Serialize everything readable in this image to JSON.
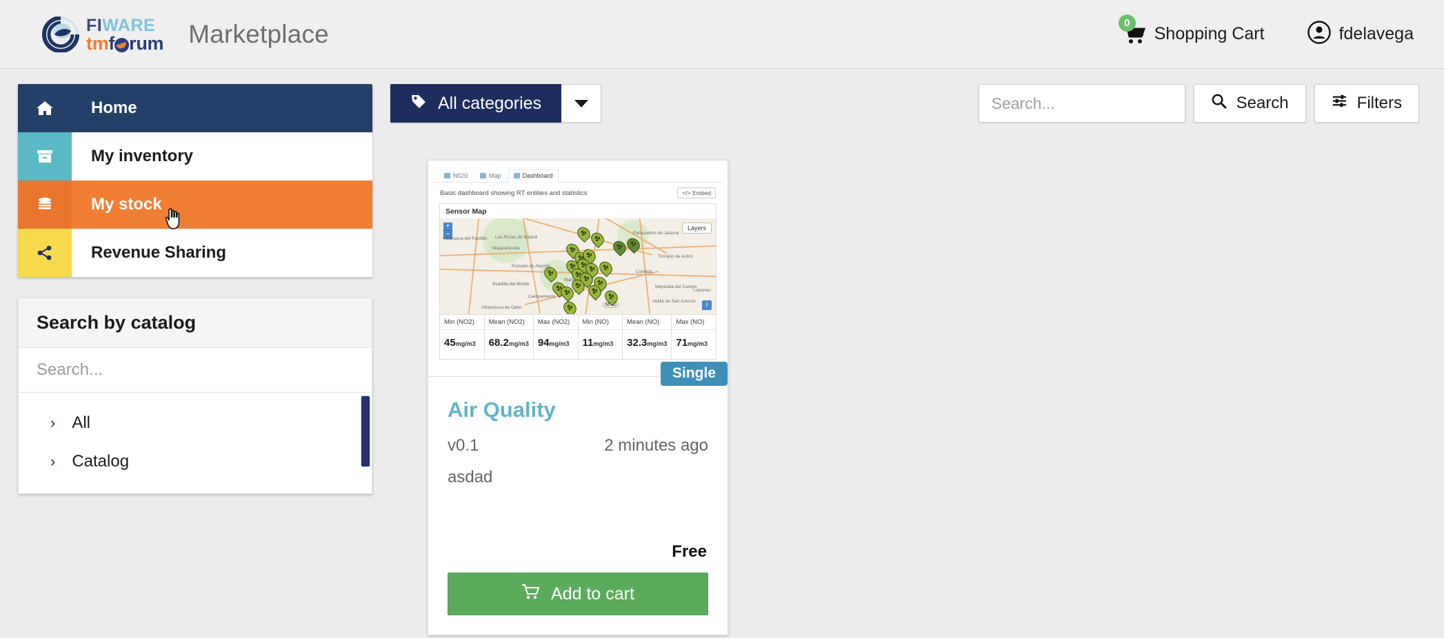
{
  "navbar": {
    "brand": {
      "fiware_fi": "FI",
      "fiware_ware": "WARE",
      "tm": "tm",
      "f": "f",
      "orum": "rum"
    },
    "app_title": "Marketplace",
    "cart": {
      "label": "Shopping Cart",
      "count": "0",
      "icon": "shopping-cart-icon"
    },
    "user": {
      "label": "fdelavega",
      "icon": "user-circle-icon"
    }
  },
  "sidebar": {
    "items": [
      {
        "label": "Home",
        "icon": "home-icon"
      },
      {
        "label": "My inventory",
        "icon": "inventory-box-icon"
      },
      {
        "label": "My stock",
        "icon": "database-stack-icon"
      },
      {
        "label": "Revenue Sharing",
        "icon": "share-nodes-icon"
      }
    ]
  },
  "catalog_panel": {
    "title": "Search by catalog",
    "search_placeholder": "Search...",
    "search_value": "",
    "rows": [
      {
        "label": "All",
        "icon": "chevron-right-icon"
      },
      {
        "label": "Catalog",
        "icon": "chevron-right-icon"
      }
    ]
  },
  "toolbar": {
    "categories_label": "All categories",
    "categories_icon": "tag-icon",
    "caret_icon": "caret-down-icon",
    "search_placeholder": "Search...",
    "search_value": "",
    "search_label": "Search",
    "search_icon": "magnifier-icon",
    "filters_label": "Filters",
    "filters_icon": "sliders-icon"
  },
  "product": {
    "badge": "Single",
    "title": "Air Quality",
    "version": "v0.1",
    "updated": "2 minutes ago",
    "description": "asdad",
    "price": "Free",
    "add_to_cart": "Add to cart",
    "add_to_cart_icon": "shopping-cart-icon",
    "thumbnail": {
      "tabs": [
        {
          "label": "NGSI",
          "icon": "file-icon",
          "active": false
        },
        {
          "label": "Map",
          "icon": "map-icon",
          "active": false
        },
        {
          "label": "Dashboard",
          "icon": "chart-icon",
          "active": true
        }
      ],
      "subtitle": "Basic dashboard showing RT entities and statistics",
      "embed_label": "Embed",
      "panel_title": "Sensor Map",
      "map": {
        "zoom_in": "+",
        "zoom_out": "−",
        "layers_label": "Layers",
        "info_label": "i",
        "highway_label": "M-40",
        "place_labels": [
          "Villanueva del Pardillo",
          "Las Rozas de Madrid",
          "Majadahonda",
          "Pozuelo de Alarcón",
          "Boadilla del Monte",
          "Campamento",
          "Villaviciosa de Odón",
          "Madrid",
          "Paracuellos de Jarama",
          "Torrejón de Ardoz",
          "Coslada",
          "Mejorada del Campo",
          "Velilla de San Antonio",
          "Loeches"
        ]
      },
      "stats": [
        {
          "header": "Min (NO2)",
          "value": "45",
          "unit": "mg/m3"
        },
        {
          "header": "Mean (NO2)",
          "value": "68.2",
          "unit": "mg/m3"
        },
        {
          "header": "Max (NO2)",
          "value": "94",
          "unit": "mg/m3"
        },
        {
          "header": "Min (NO)",
          "value": "11",
          "unit": "mg/m3"
        },
        {
          "header": "Mean (NO)",
          "value": "32.3",
          "unit": "mg/m3"
        },
        {
          "header": "Max (NO)",
          "value": "71",
          "unit": "mg/m3"
        }
      ]
    }
  },
  "colors": {
    "navy": "#243f68",
    "teal": "#5bb8c7",
    "orange": "#ef7e33",
    "yellow": "#f7d94c",
    "green": "#5cab5c",
    "badge_blue": "#3f8fb8",
    "title_blue": "#62b4c8",
    "page_bg": "#ececec"
  }
}
